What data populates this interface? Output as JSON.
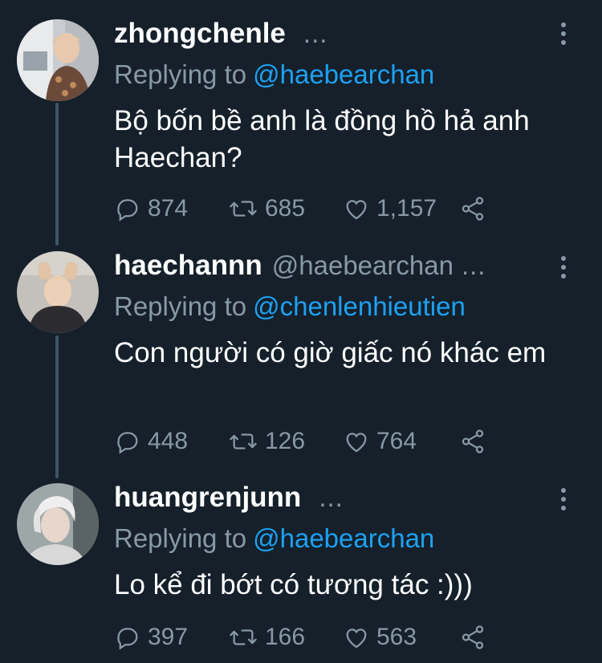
{
  "tweets": [
    {
      "name": "zhongchenle",
      "handle": "",
      "dots": "...",
      "reply_prefix": "Replying to",
      "reply_to": "@haebearchan",
      "text": "Bộ bốn bề anh là đồng hồ hả anh Haechan?",
      "replies": "874",
      "retweets": "685",
      "likes": "1,157"
    },
    {
      "name": "haechannn",
      "handle": "@haebearchan",
      "dots": "...",
      "reply_prefix": "Replying to",
      "reply_to": "@chenlenhieutien",
      "text": "Con người có giờ giấc nó khác em",
      "replies": "448",
      "retweets": "126",
      "likes": "764"
    },
    {
      "name": "huangrenjunn",
      "handle": "",
      "dots": "...",
      "reply_prefix": "Replying to",
      "reply_to": "@haebearchan",
      "text": "Lo kể đi bớt có tương tác :)))",
      "replies": "397",
      "retweets": "166",
      "likes": "563"
    }
  ],
  "colors": {
    "background": "#15202b",
    "secondary_text": "#8899a6",
    "link": "#1da1f2",
    "thread_line": "#3d5466"
  },
  "icons": [
    "reply-icon",
    "retweet-icon",
    "like-icon",
    "share-icon",
    "more-options-icon"
  ]
}
